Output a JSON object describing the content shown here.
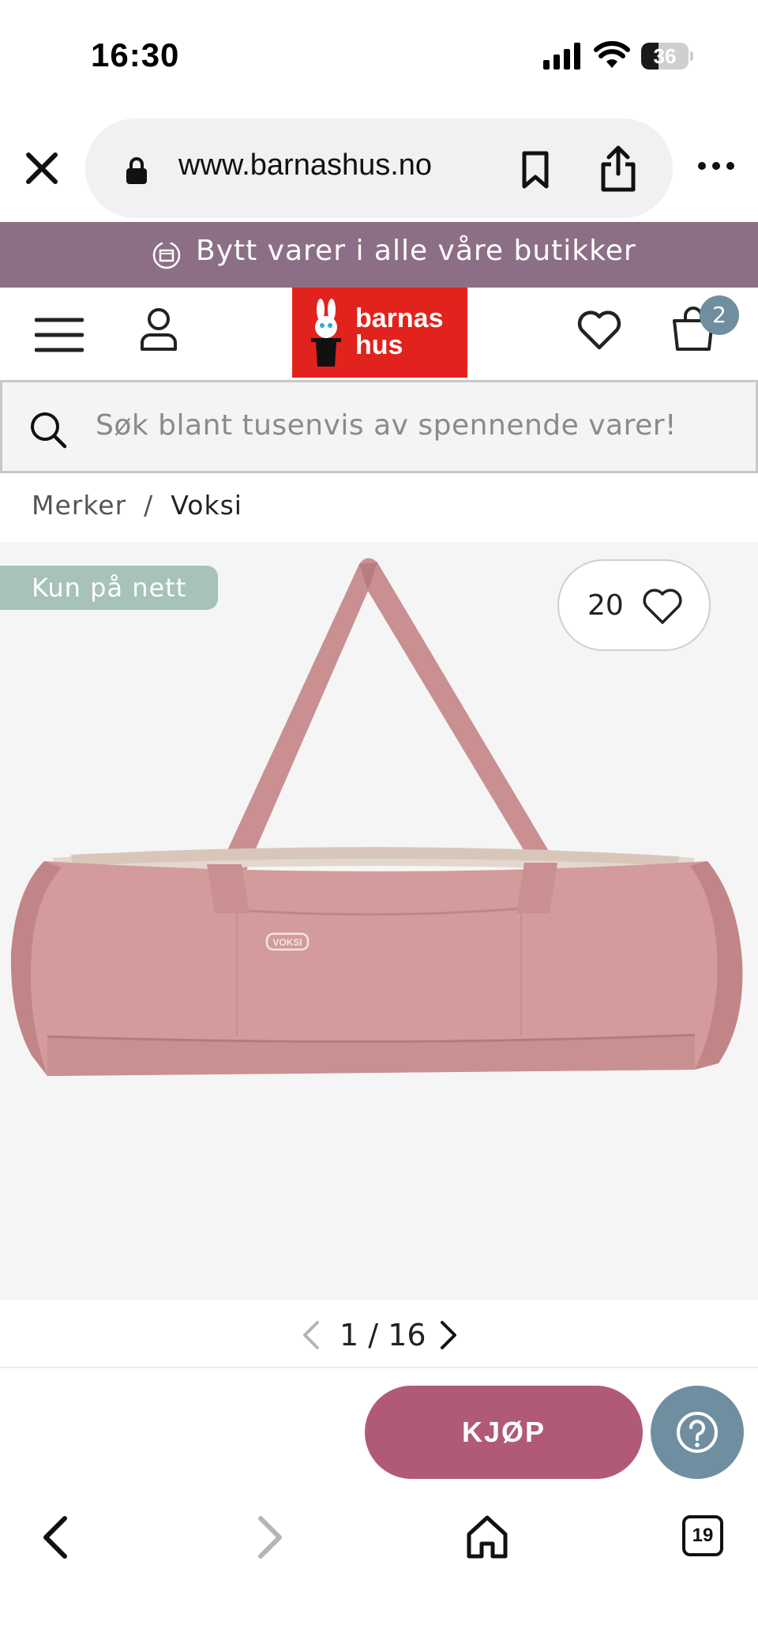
{
  "status_bar": {
    "time": "16:30",
    "battery_percent": 36,
    "battery_label": "36"
  },
  "browser": {
    "url": "www.barnashus.no",
    "icons": [
      "close-icon",
      "lock-icon",
      "bookmark-icon",
      "share-icon",
      "more-icon"
    ]
  },
  "promo": {
    "text": "Bytt varer i alle våre butikker",
    "icon": "exchange-box-icon",
    "background": "#8c6f86"
  },
  "header": {
    "logo_line1": "barnas",
    "logo_line2": "hus",
    "logo_color": "#e2221c",
    "cart_count": "2",
    "icons": [
      "menu-icon",
      "account-icon",
      "heart-icon",
      "cart-icon"
    ]
  },
  "search": {
    "placeholder": "Søk blant tusenvis av spennende varer!"
  },
  "breadcrumb": {
    "items": [
      "Merker",
      "Voksi"
    ],
    "separator": "/"
  },
  "product": {
    "badge": "Kun på nett",
    "favorite_count": "20",
    "image_brand_label": "VOKSI",
    "image_color": "#d19a9b"
  },
  "pager": {
    "current": "1",
    "separator": "/",
    "total": "16"
  },
  "actions": {
    "buy_label": "KJØP",
    "buy_color": "#b05a78",
    "help_color": "#6f8fa0"
  },
  "toolbar": {
    "tabs_count": "19"
  }
}
